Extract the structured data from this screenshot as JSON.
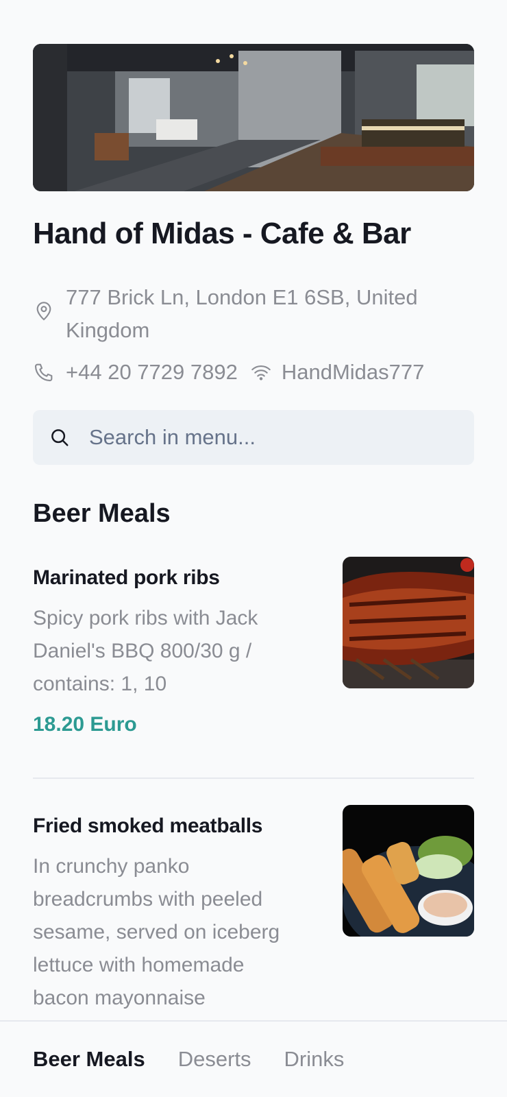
{
  "venue": {
    "name": "Hand of Midas - Cafe & Bar",
    "address": "777 Brick Ln, London E1 6SB, United Kingdom",
    "phone": "+44 20 7729 7892",
    "wifi": "HandMidas777",
    "icons": {
      "address": "location-pin-icon",
      "phone": "phone-icon",
      "wifi": "wifi-icon"
    }
  },
  "search": {
    "placeholder": "Search in menu...",
    "icon": "search-icon"
  },
  "section": {
    "title": "Beer Meals"
  },
  "items": [
    {
      "name": "Marinated pork ribs",
      "description": "Spicy pork ribs with Jack Daniel's BBQ 800/30 g / contains: 1, 10",
      "price": "18.20 Euro"
    },
    {
      "name": "Fried smoked meatballs",
      "description": "In crunchy panko breadcrumbs with peeled sesame, served on iceberg lettuce with homemade bacon mayonnaise"
    }
  ],
  "tabs": [
    {
      "label": "Beer Meals",
      "active": true
    },
    {
      "label": "Deserts",
      "active": false
    },
    {
      "label": "Drinks",
      "active": false
    }
  ],
  "colors": {
    "accent_price": "#2c9a92",
    "search_bg": "#edf1f5",
    "text_primary": "#161821",
    "text_secondary": "#8a8c93"
  }
}
